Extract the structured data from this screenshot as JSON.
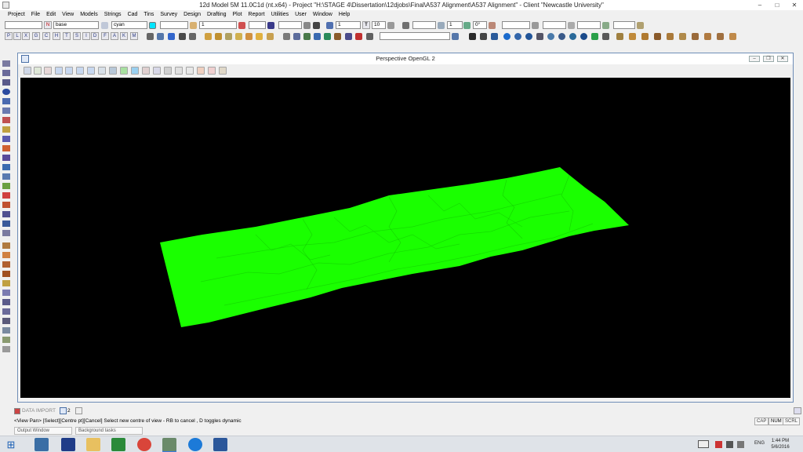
{
  "window": {
    "title": "12d Model 5M 11.0C1d (nt.x64) - Project \"H:\\STAGE 4\\Dissertation\\12djobs\\Final\\A537 Alignment\\A537 Alignment\" - Client \"Newcastle University\""
  },
  "menu": [
    "Project",
    "File",
    "Edit",
    "View",
    "Models",
    "Strings",
    "Cad",
    "Tins",
    "Survey",
    "Design",
    "Drafting",
    "Plot",
    "Report",
    "Utilities",
    "User",
    "Window",
    "Help"
  ],
  "toolbar": {
    "layer_field": "base",
    "colour_field": "cyan",
    "weight_field": "1",
    "scale_field": "1",
    "text_size": "10",
    "angle_field": "1",
    "rotation": "0°",
    "letter_buttons": [
      "P",
      "L",
      "X",
      "G",
      "C",
      "H",
      "T",
      "S",
      "I",
      "D",
      "F",
      "A",
      "K",
      "M"
    ]
  },
  "view_window": {
    "title": "Perspective OpenGL 2"
  },
  "bottom_tabs": {
    "data_import": "DATA IMPORT",
    "tab_number": "2"
  },
  "status": {
    "prompt": "<View Pan> [Select][Centre pt][Cancel] Select new centre of view - RB to cancel , D toggles dynamic",
    "indicators": [
      "CAP",
      "NUM",
      "SCRL"
    ]
  },
  "output_tabs": [
    "Output Window",
    "Background tasks"
  ],
  "taskbar": {
    "language": "ENG",
    "time": "1:44 PM",
    "date": "5/6/2016"
  },
  "colors": {
    "surface": "#1aff00",
    "viewport_bg": "#000000",
    "frame": "#6f8db7"
  }
}
